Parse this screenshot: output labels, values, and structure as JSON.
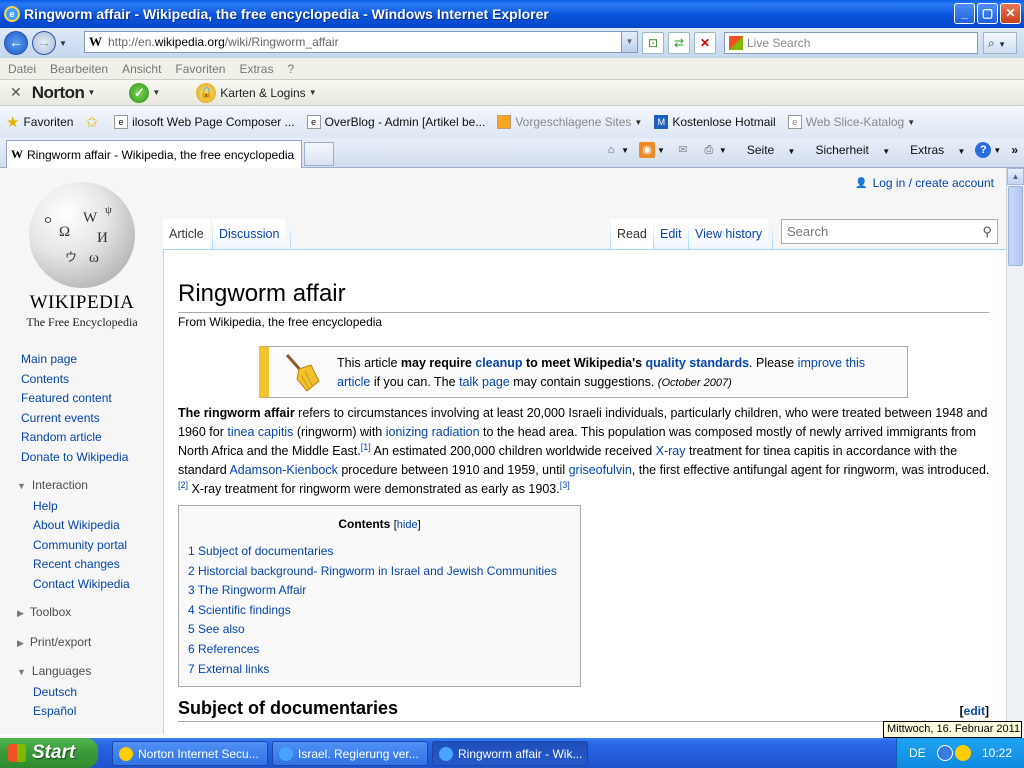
{
  "window": {
    "title": "Ringworm affair - Wikipedia, the free encyclopedia - Windows Internet Explorer",
    "min": "_",
    "max": "▢",
    "close": "✕"
  },
  "address": {
    "url_prefix": "http://en.",
    "url_domain": "wikipedia.org",
    "url_path": "/wiki/Ringworm_affair",
    "search_placeholder": "Live Search"
  },
  "menu": [
    "Datei",
    "Bearbeiten",
    "Ansicht",
    "Favoriten",
    "Extras",
    "?"
  ],
  "norton": {
    "brand": "Norton",
    "logins": "Karten & Logins"
  },
  "favorites": {
    "label": "Favoriten",
    "items": [
      "ilosoft Web Page Composer ...",
      "OverBlog - Admin [Artikel be...",
      "Vorgeschlagene Sites",
      "Kostenlose Hotmail",
      "Web Slice-Katalog"
    ]
  },
  "tab": {
    "title": "Ringworm affair - Wikipedia, the free encyclopedia"
  },
  "commandbar": {
    "page": "Seite",
    "security": "Sicherheit",
    "tools": "Extras",
    "more": "»"
  },
  "wiki": {
    "logo_word": "WIKIPEDIA",
    "tagline": "The Free Encyclopedia",
    "nav": [
      "Main page",
      "Contents",
      "Featured content",
      "Current events",
      "Random article",
      "Donate to Wikipedia"
    ],
    "interaction": {
      "head": "Interaction",
      "items": [
        "Help",
        "About Wikipedia",
        "Community portal",
        "Recent changes",
        "Contact Wikipedia"
      ]
    },
    "toolbox": "Toolbox",
    "print": "Print/export",
    "languages": {
      "head": "Languages",
      "items": [
        "Deutsch",
        "Español"
      ]
    },
    "login": "Log in / create account",
    "tabs": {
      "article": "Article",
      "discussion": "Discussion",
      "read": "Read",
      "edit": "Edit",
      "history": "View history"
    },
    "search_placeholder": "Search",
    "title": "Ringworm affair",
    "sitesub": "From Wikipedia, the free encyclopedia",
    "ambox": {
      "p1": "This article ",
      "b1": "may require ",
      "l1": "cleanup",
      "b2": " to meet Wikipedia's ",
      "l2": "quality standards",
      "p2": ". Please ",
      "l3": "improve this article",
      "p3": " if you can. The ",
      "l4": "talk page",
      "p4": " may contain suggestions. ",
      "date": "(October 2007)"
    },
    "lead": {
      "bold": "The ringworm affair",
      "t1": " refers to circumstances involving at least 20,000 Israeli individuals, particularly children, who were treated between 1948 and 1960 for ",
      "l_tinea": "tinea capitis",
      "t2": " (ringworm) with ",
      "l_ion": "ionizing radiation",
      "t3": " to the head area. This population was composed mostly of newly arrived immigrants from North Africa and the Middle East.",
      "ref1": "[1]",
      "t4": " An estimated 200,000 children worldwide received ",
      "l_xray": "X-ray",
      "t5": " treatment for tinea capitis in accordance with the standard ",
      "l_adam": "Adamson-Kienbock",
      "t6": " procedure between 1910 and 1959, until ",
      "l_gris": "griseofulvin",
      "t7": ", the first effective antifungal agent for ringworm, was introduced.",
      "ref2": "[2]",
      "t8": " X-ray treatment for ringworm were demonstrated as early as 1903.",
      "ref3": "[3]"
    },
    "toc": {
      "title": "Contents",
      "hide": "hide",
      "items": [
        "1 Subject of documentaries",
        "2 Historcial background- Ringworm in Israel and Jewish Communities",
        "3 The Ringworm Affair",
        "4 Scientific findings",
        "5 See also",
        "6 References",
        "7 External links"
      ]
    },
    "section1": {
      "title": "Subject of documentaries",
      "edit": "edit"
    }
  },
  "tooltip": "Mittwoch, 16. Februar 2011",
  "taskbar": {
    "start": "Start",
    "tasks": [
      "Norton Internet Secu...",
      "Israel. Regierung ver...",
      "Ringworm affair - Wik..."
    ],
    "lang": "DE",
    "time": "10:22"
  }
}
